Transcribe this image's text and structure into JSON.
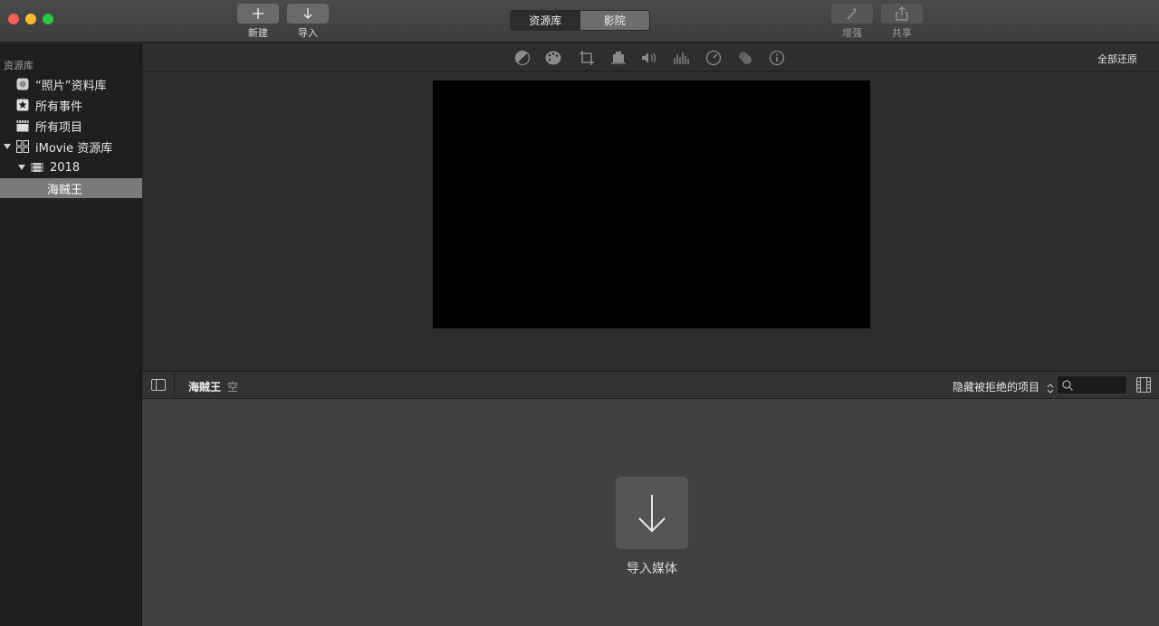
{
  "toolbar": {
    "new_label": "新建",
    "import_label": "导入",
    "enhance_label": "增强",
    "share_label": "共享",
    "seg_library": "资源库",
    "seg_theater": "影院"
  },
  "sidebar": {
    "header": "资源库",
    "items": [
      {
        "label": "“照片”资料库",
        "icon": "photos-icon"
      },
      {
        "label": "所有事件",
        "icon": "star-icon"
      },
      {
        "label": "所有项目",
        "icon": "clapper-icon"
      },
      {
        "label": "iMovie 资源库",
        "icon": "grid-icon"
      },
      {
        "label": "2018",
        "icon": "film-icon"
      },
      {
        "label": "海贼王",
        "icon": ""
      }
    ]
  },
  "viewer": {
    "restore_all": "全部还原",
    "adjust_icons": [
      "color-balance-icon",
      "color-palette-icon",
      "crop-icon",
      "stabilization-icon",
      "volume-icon",
      "equalizer-icon",
      "speed-icon",
      "filter-icon",
      "info-icon"
    ]
  },
  "browser": {
    "title": "海贼王",
    "status": "空",
    "filter": "隐藏被拒绝的项目",
    "search_placeholder": ""
  },
  "content": {
    "import_media": "导入媒体"
  }
}
